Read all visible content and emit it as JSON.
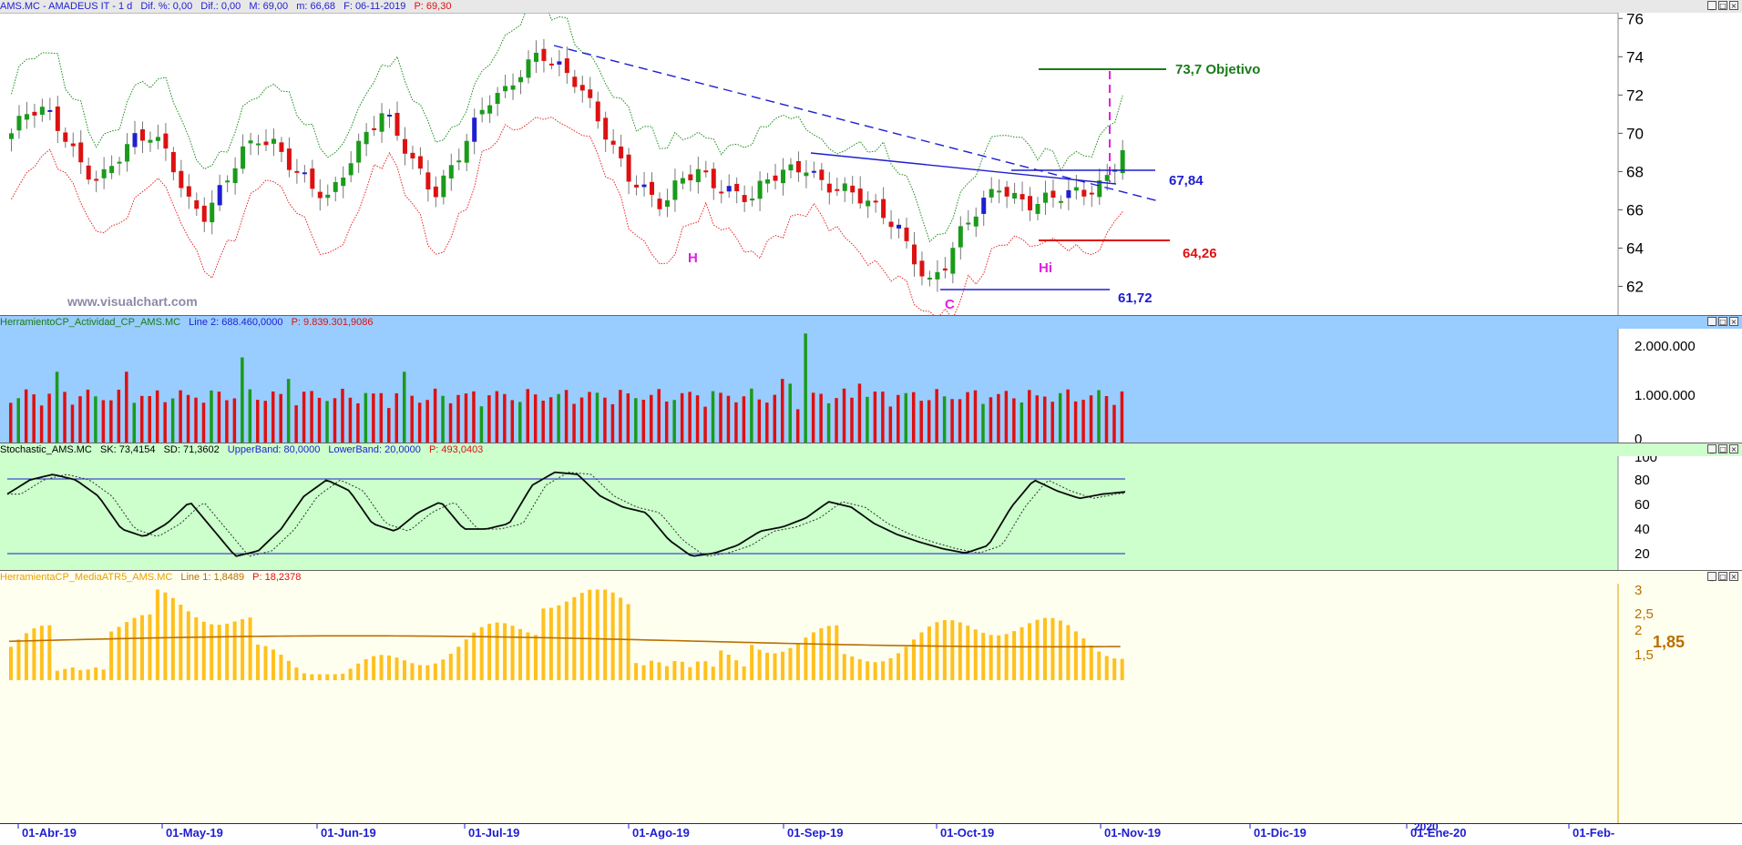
{
  "colors": {
    "bull": "#1a9b1a",
    "bear": "#dd1111",
    "neutral": "#1e1ed2",
    "upper_band": "#1a8a1a",
    "lower_band": "#e62424",
    "trend": "#1e1ed2",
    "objective": "#1a7a1a",
    "support": "#dd1111",
    "annot": "#e020e0",
    "vol_bg": "#99ccff",
    "stoch_bg": "#ccffcc",
    "atr_bg": "#fffff0",
    "atr_bar": "#ffc020",
    "atr_line": "#b87000"
  },
  "price_pane": {
    "header": {
      "symbol": "AMS.MC - AMADEUS IT - 1 d",
      "dif_pct": "Dif. %: 0,00",
      "dif": "Dif.: 0,00",
      "high": "M: 69,00",
      "low": "m: 66,68",
      "date": "F: 06-11-2019",
      "price": "P: 69,30"
    },
    "y_ticks": [
      "62",
      "64",
      "66",
      "68",
      "70",
      "72",
      "74",
      "76"
    ],
    "watermark": "www.visualchart.com",
    "labels": {
      "objective": "73,7 Objetivo",
      "resistance": "67,84",
      "support": "64,26",
      "low_level": "61,72",
      "h": "H",
      "hi": "Hi",
      "c": "C"
    }
  },
  "volume_pane": {
    "header": {
      "name": "HerramientoCP_Actividad_CP_AMS.MC",
      "line2": "Line 2: 688.460,0000",
      "p": "P: 9.839.301,9086"
    },
    "y_ticks": [
      "0",
      "1.000.000",
      "2.000.000"
    ]
  },
  "stoch_pane": {
    "header": {
      "name": "Stochastic_AMS.MC",
      "sk": "SK: 73,4154",
      "sd": "SD: 71,3602",
      "upper": "UpperBand: 80,0000",
      "lower": "LowerBand: 20,0000",
      "p": "P: 493,0403"
    },
    "y_ticks": [
      "20",
      "40",
      "60",
      "80",
      "100"
    ]
  },
  "atr_pane": {
    "header": {
      "name": "HerramientaCP_MediaATR5_AMS.MC",
      "line1": "Line 1: 1,8489",
      "p": "P: 18,2378"
    },
    "y_ticks": [
      "1,5",
      "2",
      "2,5",
      "3"
    ],
    "current": "1,85"
  },
  "x_axis": {
    "labels": [
      "01-Abr-19",
      "01-May-19",
      "01-Jun-19",
      "01-Jul-19",
      "01-Ago-19",
      "01-Sep-19",
      "01-Oct-19",
      "01-Nov-19",
      "01-Dic-19",
      "01-Ene-20",
      "01-Feb-"
    ],
    "year_marker": "2020"
  },
  "chart_data": {
    "type": "candlestick",
    "price_range": [
      60.5,
      76.3
    ],
    "key_levels": {
      "objective": 73.7,
      "resistance": 67.84,
      "support": 64.26,
      "low": 61.72
    },
    "last": {
      "high": 69.0,
      "low": 66.68,
      "close": 69.3,
      "date": "06-11-2019"
    },
    "price_path": [
      70,
      71,
      71,
      70,
      68.5,
      67.5,
      68.5,
      69.5,
      70,
      69,
      66.5,
      65.5,
      67,
      69,
      70,
      69.5,
      68,
      67,
      66.5,
      68.5,
      70,
      71,
      69.5,
      68,
      67,
      68.5,
      70,
      71.5,
      72,
      73.5,
      74.5,
      73.5,
      72.5,
      71,
      69.5,
      68,
      67,
      66,
      67.5,
      68,
      67.5,
      67,
      66.5,
      67.5,
      68,
      68.5,
      67.5,
      67,
      66.5,
      66,
      65.5,
      64,
      62,
      63,
      65,
      66.5,
      67.5,
      66.5,
      66,
      66.5,
      67,
      67.2,
      67.5,
      69
    ],
    "volume_range": [
      0,
      2400000
    ],
    "volume_up_to_nov": "approx 400k-2.3M, peak ~2.3M mid-Sep",
    "stochastic": {
      "upper_band": 80,
      "lower_band": 20,
      "sk_last": 73.4154,
      "sd_last": 71.3602,
      "sk_path": [
        72,
        85,
        90,
        85,
        70,
        40,
        33,
        45,
        65,
        40,
        15,
        20,
        40,
        70,
        85,
        75,
        45,
        38,
        55,
        65,
        40,
        40,
        45,
        80,
        92,
        90,
        70,
        60,
        55,
        30,
        15,
        18,
        25,
        38,
        42,
        50,
        65,
        60,
        45,
        35,
        28,
        22,
        18,
        25,
        60,
        85,
        75,
        68,
        72,
        74
      ]
    },
    "atr": {
      "line1_last": 1.8489,
      "current": 1.85,
      "range": [
        1.25,
        3.2
      ]
    }
  }
}
